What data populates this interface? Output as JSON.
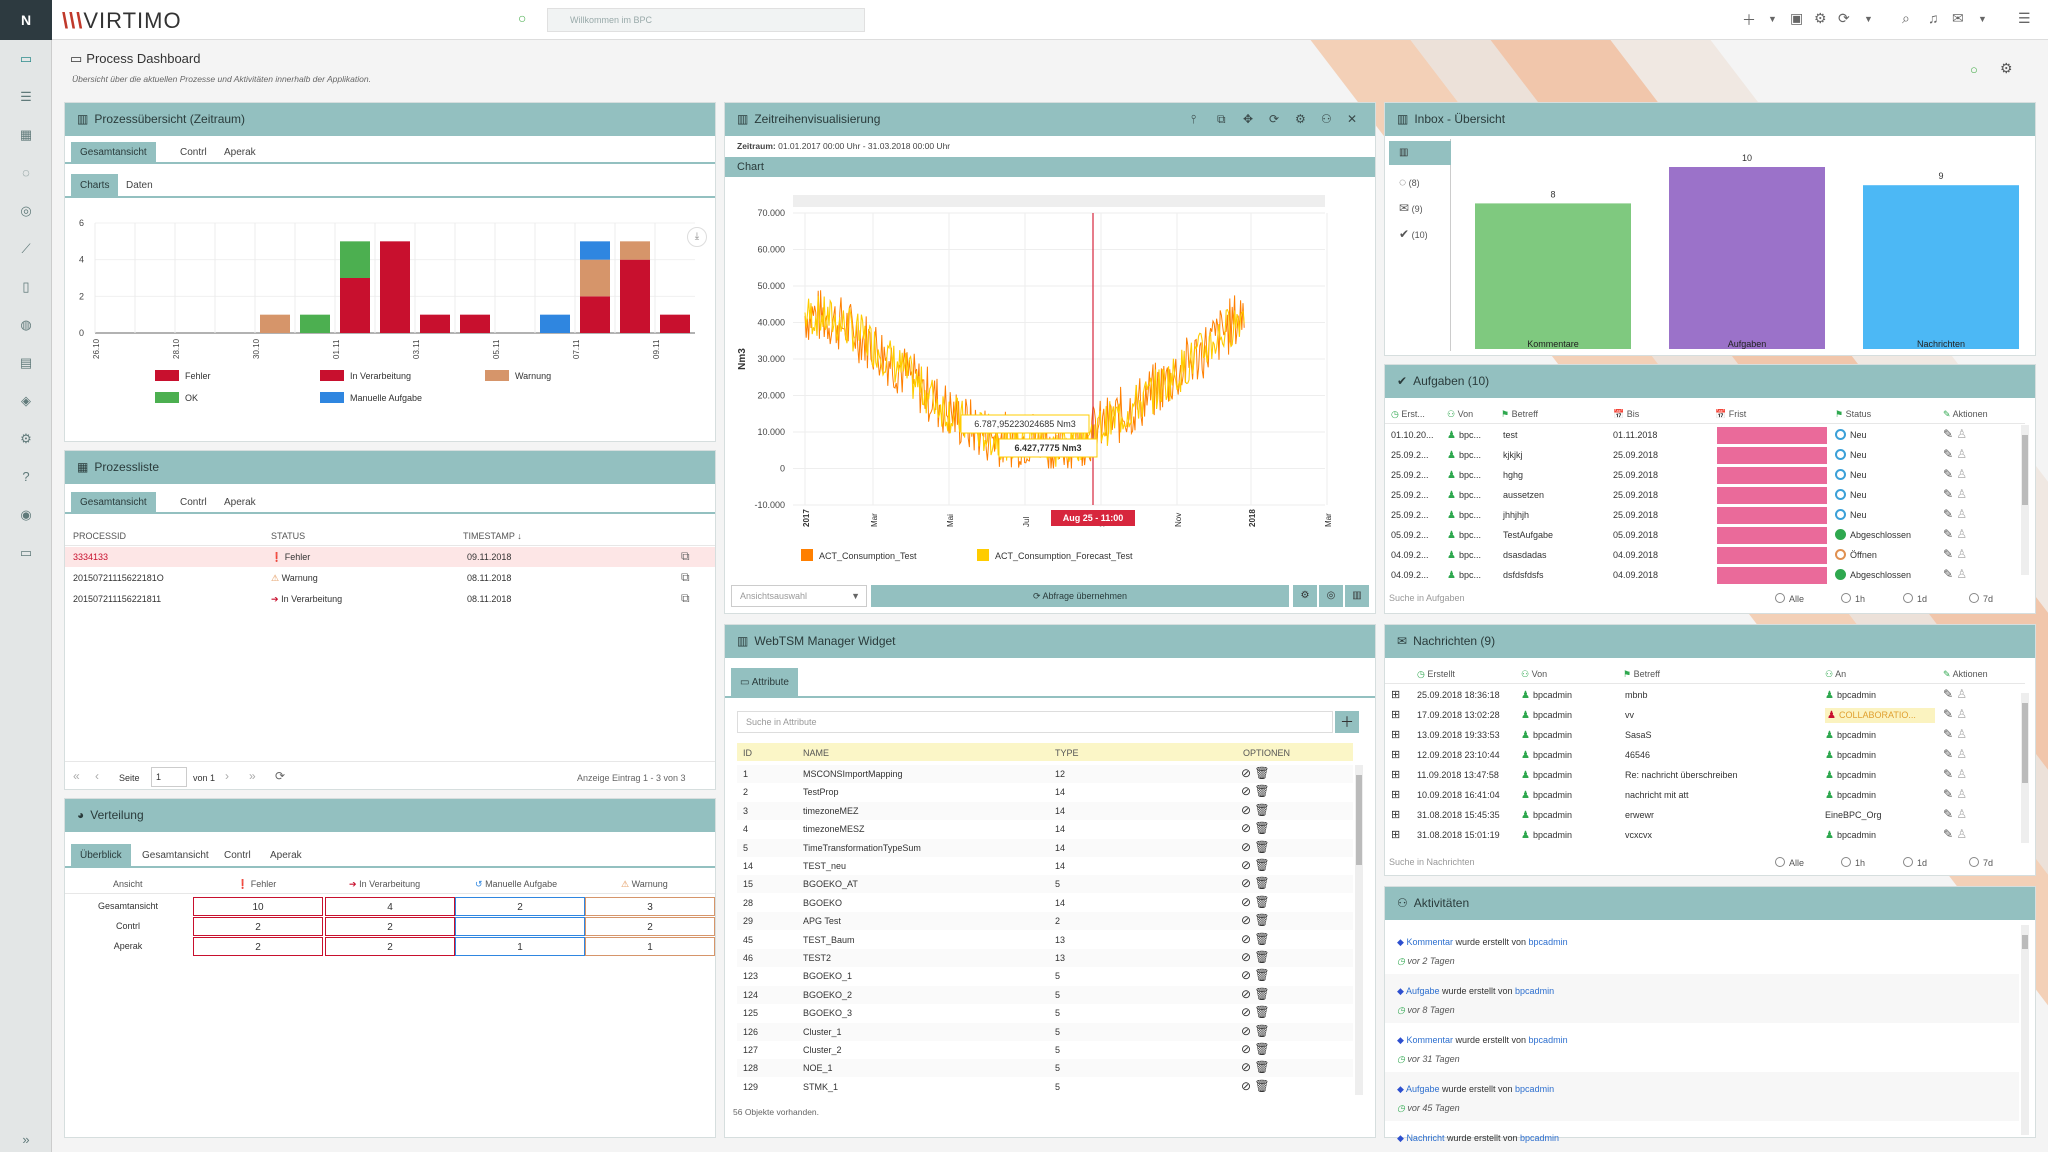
{
  "topbar": {
    "brand_prefix": "\\\\\\",
    "brand": "VIRTIMO",
    "search_placeholder": "Willkommen im BPC"
  },
  "page": {
    "title": "Process Dashboard",
    "subtitle": "Übersicht über die aktuellen Prozesse und Aktivitäten innerhalb der Applikation."
  },
  "proc_overview": {
    "title": "Prozessübersicht (Zeitraum)",
    "tabs": [
      "Gesamtansicht",
      "Contrl",
      "Aperak"
    ],
    "subtabs": [
      "Charts",
      "Daten"
    ],
    "chart_data": {
      "type": "bar",
      "stacked": true,
      "y_ticks": [
        "6",
        "4",
        "2",
        "0"
      ],
      "ylim": [
        0,
        6
      ],
      "categories": [
        "26.10",
        "",
        "28.10",
        "",
        "30.10",
        "",
        "01.11",
        "",
        "03.11",
        "",
        "05.11",
        "",
        "07.11",
        "",
        "09.11"
      ],
      "series": [
        {
          "name": "Fehler",
          "color": "#c8102e",
          "values": [
            0,
            0,
            0,
            0,
            0,
            0,
            0,
            0,
            0,
            0,
            0,
            0,
            0,
            0,
            0
          ]
        },
        {
          "name": "In Verarbeitung",
          "color": "#c8102e",
          "values": [
            0,
            0,
            0,
            0,
            0,
            0,
            3,
            5,
            1,
            1,
            0,
            0,
            2,
            4,
            1
          ]
        },
        {
          "name": "Warnung",
          "color": "#d6956a",
          "values": [
            0,
            0,
            0,
            0,
            1,
            0,
            0,
            0,
            0,
            0,
            0,
            0,
            2,
            1,
            0
          ]
        },
        {
          "name": "OK",
          "color": "#4caf50",
          "values": [
            0,
            0,
            0,
            0,
            0,
            1,
            2,
            0,
            0,
            0,
            0,
            0,
            0,
            0,
            0
          ]
        },
        {
          "name": "Manuelle Aufgabe",
          "color": "#2f86e0",
          "values": [
            0,
            0,
            0,
            0,
            0,
            0,
            0,
            0,
            0,
            0,
            0,
            1,
            1,
            0,
            0
          ]
        }
      ]
    }
  },
  "proc_list": {
    "title": "Prozessliste",
    "tabs": [
      "Gesamtansicht",
      "Contrl",
      "Aperak"
    ],
    "headers": [
      "PROCESSID",
      "STATUS",
      "TIMESTAMP"
    ],
    "rows": [
      [
        "3334133",
        "Fehler",
        "09.11.2018"
      ],
      [
        "20150721115622181O",
        "Warnung",
        "08.11.2018"
      ],
      [
        "201507211156221811",
        "In Verarbeitung",
        "08.11.2018"
      ]
    ],
    "pager": {
      "seite": "Seite",
      "page": "1",
      "von": "von 1",
      "info": "Anzeige Eintrag 1 - 3 von 3"
    }
  },
  "verteilung": {
    "title": "Verteilung",
    "tabs": [
      "Überblick",
      "Gesamtansicht",
      "Contrl",
      "Aperak"
    ],
    "headers": [
      "Ansicht",
      "Fehler",
      "In Verarbeitung",
      "Manuelle Aufgabe",
      "Warnung"
    ],
    "rows": [
      [
        "Gesamtansicht",
        "10",
        "4",
        "2",
        "3"
      ],
      [
        "Contrl",
        "2",
        "2",
        "",
        "2"
      ],
      [
        "Aperak",
        "2",
        "2",
        "1",
        "1"
      ]
    ]
  },
  "timeseries": {
    "title": "Zeitreihenvisualisierung",
    "zeitraum_label": "Zeitraum:",
    "zeitraum": "01.01.2017 00:00 Uhr - 31.03.2018 00:00 Uhr",
    "chart_label": "Chart",
    "chart_data": {
      "type": "line",
      "ylabel": "Nm3",
      "y_ticks": [
        "70.000",
        "60.000",
        "50.000",
        "40.000",
        "30.000",
        "20.000",
        "10.000",
        "0",
        "-10.000"
      ],
      "ylim": [
        -10000,
        70000
      ],
      "x_ticks": [
        "2017",
        "Mar",
        "Mai",
        "Jul",
        "Sep",
        "Nov",
        "2018",
        "Mar"
      ],
      "cursor_label": "Aug 25 - 11:00",
      "tooltip1": "6.787,95223024685 Nm3",
      "tooltip2": "6.427,7775 Nm3",
      "series": [
        {
          "name": "ACT_Consumption_Test",
          "color": "#ff7f00"
        },
        {
          "name": "ACT_Consumption_Forecast_Test",
          "color": "#ffcc00"
        }
      ]
    },
    "select_placeholder": "Ansichtsauswahl",
    "apply_label": "Abfrage übernehmen"
  },
  "webtsm": {
    "title": "WebTSM Manager Widget",
    "tab": "Attribute",
    "search_placeholder": "Suche in Attribute",
    "headers": [
      "ID",
      "NAME",
      "TYPE",
      "OPTIONEN"
    ],
    "rows": [
      [
        "1",
        "MSCONSImportMapping",
        "12"
      ],
      [
        "2",
        "TestProp",
        "14"
      ],
      [
        "3",
        "timezoneMEZ",
        "14"
      ],
      [
        "4",
        "timezoneMESZ",
        "14"
      ],
      [
        "5",
        "TimeTransformationTypeSum",
        "14"
      ],
      [
        "14",
        "TEST_neu",
        "14"
      ],
      [
        "15",
        "BGOEKO_AT",
        "5"
      ],
      [
        "28",
        "BGOEKO",
        "14"
      ],
      [
        "29",
        "APG Test",
        "2"
      ],
      [
        "45",
        "TEST_Baum",
        "13"
      ],
      [
        "46",
        "TEST2",
        "13"
      ],
      [
        "123",
        "BGOEKO_1",
        "5"
      ],
      [
        "124",
        "BGOEKO_2",
        "5"
      ],
      [
        "125",
        "BGOEKO_3",
        "5"
      ],
      [
        "126",
        "Cluster_1",
        "5"
      ],
      [
        "127",
        "Cluster_2",
        "5"
      ],
      [
        "128",
        "NOE_1",
        "5"
      ],
      [
        "129",
        "STMK_1",
        "5"
      ]
    ],
    "footer": "56 Objekte vorhanden."
  },
  "inbox": {
    "title": "Inbox - Übersicht",
    "side": [
      "(8)",
      "(9)",
      "(10)"
    ],
    "chart_data": {
      "type": "bar",
      "categories": [
        "Kommentare",
        "Aufgaben",
        "Nachrichten"
      ],
      "values": [
        8,
        10,
        9
      ],
      "colors": [
        "#7fc97f",
        "#9b72c9",
        "#4cb8f5"
      ],
      "ylim": [
        0,
        10
      ]
    }
  },
  "aufgaben": {
    "title": "Aufgaben (10)",
    "headers": [
      "Erst...",
      "Von",
      "Betreff",
      "Bis",
      "Frist",
      "Status",
      "Aktionen"
    ],
    "rows": [
      [
        "01.10.20...",
        "bpc...",
        "test",
        "01.11.2018",
        "Neu"
      ],
      [
        "25.09.2...",
        "bpc...",
        "kjkjkj",
        "25.09.2018",
        "Neu"
      ],
      [
        "25.09.2...",
        "bpc...",
        "hghg",
        "25.09.2018",
        "Neu"
      ],
      [
        "25.09.2...",
        "bpc...",
        "aussetzen",
        "25.09.2018",
        "Neu"
      ],
      [
        "25.09.2...",
        "bpc...",
        "jhhjhjh",
        "25.09.2018",
        "Neu"
      ],
      [
        "05.09.2...",
        "bpc...",
        "TestAufgabe",
        "05.09.2018",
        "Abgeschlossen"
      ],
      [
        "04.09.2...",
        "bpc...",
        "dsasdadas",
        "04.09.2018",
        "Öffnen"
      ],
      [
        "04.09.2...",
        "bpc...",
        "dsfdsfdsfs",
        "04.09.2018",
        "Abgeschlossen"
      ]
    ],
    "search_placeholder": "Suche in Aufgaben",
    "filters": [
      "Alle",
      "1h",
      "1d",
      "7d"
    ]
  },
  "nachrichten": {
    "title": "Nachrichten (9)",
    "headers": [
      "Erstellt",
      "Von",
      "Betreff",
      "An",
      "Aktionen"
    ],
    "rows": [
      [
        "25.09.2018 18:36:18",
        "bpcadmin",
        "mbnb",
        "bpcadmin"
      ],
      [
        "17.09.2018 13:02:28",
        "bpcadmin",
        "vv",
        "COLLABORATIO..."
      ],
      [
        "13.09.2018 19:33:53",
        "bpcadmin",
        "SasaS",
        "bpcadmin"
      ],
      [
        "12.09.2018 23:10:44",
        "bpcadmin",
        "46546",
        "bpcadmin"
      ],
      [
        "11.09.2018 13:47:58",
        "bpcadmin",
        "Re: nachricht überschreiben",
        "bpcadmin"
      ],
      [
        "10.09.2018 16:41:04",
        "bpcadmin",
        "nachricht mit att",
        "bpcadmin"
      ],
      [
        "31.08.2018 15:45:35",
        "bpcadmin",
        "erwewr",
        "EineBPC_Org"
      ],
      [
        "31.08.2018 15:01:19",
        "bpcadmin",
        "vcxcvx",
        "bpcadmin"
      ]
    ],
    "search_placeholder": "Suche in Nachrichten",
    "filters": [
      "Alle",
      "1h",
      "1d",
      "7d"
    ]
  },
  "aktivitaeten": {
    "title": "Aktivitäten",
    "mid": "wurde erstellt von",
    "user": "bpcadmin",
    "items": [
      [
        "Kommentar",
        "vor 2 Tagen"
      ],
      [
        "Aufgabe",
        "vor 8 Tagen"
      ],
      [
        "Kommentar",
        "vor 31 Tagen"
      ],
      [
        "Aufgabe",
        "vor 45 Tagen"
      ],
      [
        "Nachricht",
        ""
      ]
    ]
  }
}
